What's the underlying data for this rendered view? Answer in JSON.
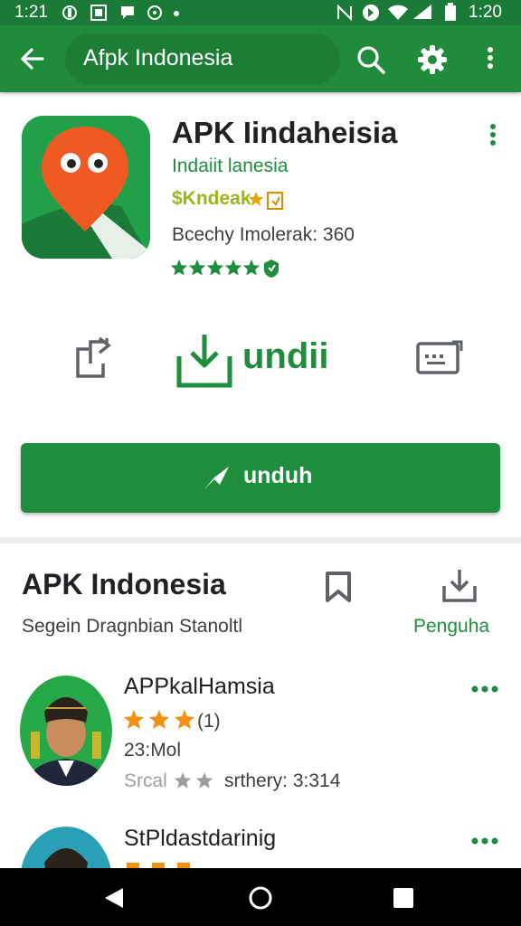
{
  "status_bar": {
    "time_left": "1:21",
    "time_right": "1:20"
  },
  "toolbar": {
    "back_icon": "arrow-left-icon",
    "search_text": "Afpk Indonesia"
  },
  "app": {
    "title": "APK Iindaheisia",
    "developer": "Indaiit lanesia",
    "tag": "$Kndeak",
    "stats": "Bcechy  Imolerak: 360",
    "rating_stars": 5
  },
  "actions": {
    "primary_label": "undii",
    "button_label": "unduh"
  },
  "section": {
    "title": "APK Indonesia",
    "subtitle": "Segein Dragnbian Stanoltl",
    "download_label": "Penguha"
  },
  "list": [
    {
      "name": "APPkalHamsia",
      "rating_text": "(1)",
      "stars": 3,
      "meta1": "23:Mol",
      "meta2_prefix": "Srcal",
      "meta2": "srthery: 3:314"
    },
    {
      "name": "StPldastdarinig",
      "stars": 3
    }
  ],
  "colors": {
    "primary": "#1e8e3e",
    "toolbar": "#1f8b3b",
    "status": "#1b7a37",
    "star_orange": "#f29111",
    "icon_red": "#f05a22"
  }
}
